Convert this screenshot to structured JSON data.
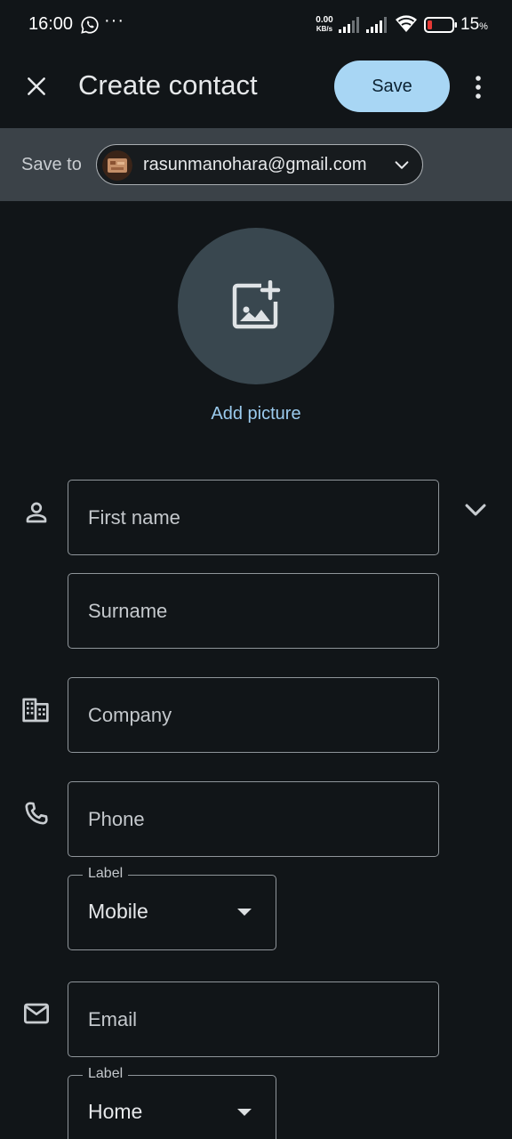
{
  "status_bar": {
    "time": "16:00",
    "more_indicator": "···",
    "net_speed_value": "0.00",
    "net_speed_unit": "KB/s",
    "battery_value": "15",
    "battery_unit": "%",
    "icons": [
      "whatsapp-icon",
      "signal-icon",
      "signal-icon",
      "wifi-icon",
      "battery-low-icon"
    ]
  },
  "app_bar": {
    "title": "Create contact",
    "save_label": "Save",
    "icons": [
      "close-icon",
      "more-vert-icon"
    ]
  },
  "save_to": {
    "label": "Save to",
    "account_email": "rasunmanohara@gmail.com",
    "icons": [
      "avatar",
      "chevron-down-icon"
    ]
  },
  "picture": {
    "add_label": "Add picture",
    "icon": "add-photo-icon"
  },
  "form": {
    "first_name_placeholder": "First name",
    "surname_placeholder": "Surname",
    "company_placeholder": "Company",
    "phone_placeholder": "Phone",
    "phone_label_legend": "Label",
    "phone_label_value": "Mobile",
    "email_placeholder": "Email",
    "email_label_legend": "Label",
    "email_label_value": "Home",
    "icons": [
      "person-icon",
      "chevron-down-icon",
      "business-icon",
      "phone-icon",
      "email-icon"
    ]
  },
  "colors": {
    "background": "#111518",
    "save_button": "#a8d6f4",
    "save_to_bar": "#3b4248",
    "photo_circle": "#39474f",
    "link": "#9bcbee",
    "battery_warning": "#e53935"
  }
}
